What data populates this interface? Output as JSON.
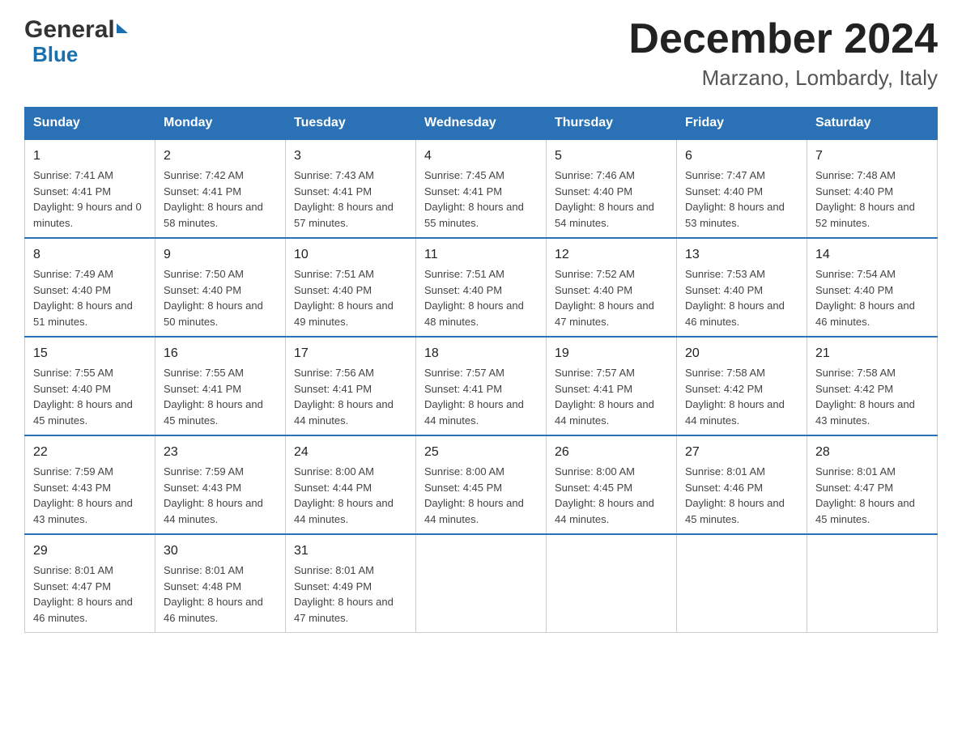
{
  "logo": {
    "line1": "General",
    "line2": "Blue"
  },
  "title": "December 2024",
  "subtitle": "Marzano, Lombardy, Italy",
  "days_of_week": [
    "Sunday",
    "Monday",
    "Tuesday",
    "Wednesday",
    "Thursday",
    "Friday",
    "Saturday"
  ],
  "weeks": [
    [
      {
        "day": "1",
        "sunrise": "7:41 AM",
        "sunset": "4:41 PM",
        "daylight": "9 hours and 0 minutes."
      },
      {
        "day": "2",
        "sunrise": "7:42 AM",
        "sunset": "4:41 PM",
        "daylight": "8 hours and 58 minutes."
      },
      {
        "day": "3",
        "sunrise": "7:43 AM",
        "sunset": "4:41 PM",
        "daylight": "8 hours and 57 minutes."
      },
      {
        "day": "4",
        "sunrise": "7:45 AM",
        "sunset": "4:41 PM",
        "daylight": "8 hours and 55 minutes."
      },
      {
        "day": "5",
        "sunrise": "7:46 AM",
        "sunset": "4:40 PM",
        "daylight": "8 hours and 54 minutes."
      },
      {
        "day": "6",
        "sunrise": "7:47 AM",
        "sunset": "4:40 PM",
        "daylight": "8 hours and 53 minutes."
      },
      {
        "day": "7",
        "sunrise": "7:48 AM",
        "sunset": "4:40 PM",
        "daylight": "8 hours and 52 minutes."
      }
    ],
    [
      {
        "day": "8",
        "sunrise": "7:49 AM",
        "sunset": "4:40 PM",
        "daylight": "8 hours and 51 minutes."
      },
      {
        "day": "9",
        "sunrise": "7:50 AM",
        "sunset": "4:40 PM",
        "daylight": "8 hours and 50 minutes."
      },
      {
        "day": "10",
        "sunrise": "7:51 AM",
        "sunset": "4:40 PM",
        "daylight": "8 hours and 49 minutes."
      },
      {
        "day": "11",
        "sunrise": "7:51 AM",
        "sunset": "4:40 PM",
        "daylight": "8 hours and 48 minutes."
      },
      {
        "day": "12",
        "sunrise": "7:52 AM",
        "sunset": "4:40 PM",
        "daylight": "8 hours and 47 minutes."
      },
      {
        "day": "13",
        "sunrise": "7:53 AM",
        "sunset": "4:40 PM",
        "daylight": "8 hours and 46 minutes."
      },
      {
        "day": "14",
        "sunrise": "7:54 AM",
        "sunset": "4:40 PM",
        "daylight": "8 hours and 46 minutes."
      }
    ],
    [
      {
        "day": "15",
        "sunrise": "7:55 AM",
        "sunset": "4:40 PM",
        "daylight": "8 hours and 45 minutes."
      },
      {
        "day": "16",
        "sunrise": "7:55 AM",
        "sunset": "4:41 PM",
        "daylight": "8 hours and 45 minutes."
      },
      {
        "day": "17",
        "sunrise": "7:56 AM",
        "sunset": "4:41 PM",
        "daylight": "8 hours and 44 minutes."
      },
      {
        "day": "18",
        "sunrise": "7:57 AM",
        "sunset": "4:41 PM",
        "daylight": "8 hours and 44 minutes."
      },
      {
        "day": "19",
        "sunrise": "7:57 AM",
        "sunset": "4:41 PM",
        "daylight": "8 hours and 44 minutes."
      },
      {
        "day": "20",
        "sunrise": "7:58 AM",
        "sunset": "4:42 PM",
        "daylight": "8 hours and 44 minutes."
      },
      {
        "day": "21",
        "sunrise": "7:58 AM",
        "sunset": "4:42 PM",
        "daylight": "8 hours and 43 minutes."
      }
    ],
    [
      {
        "day": "22",
        "sunrise": "7:59 AM",
        "sunset": "4:43 PM",
        "daylight": "8 hours and 43 minutes."
      },
      {
        "day": "23",
        "sunrise": "7:59 AM",
        "sunset": "4:43 PM",
        "daylight": "8 hours and 44 minutes."
      },
      {
        "day": "24",
        "sunrise": "8:00 AM",
        "sunset": "4:44 PM",
        "daylight": "8 hours and 44 minutes."
      },
      {
        "day": "25",
        "sunrise": "8:00 AM",
        "sunset": "4:45 PM",
        "daylight": "8 hours and 44 minutes."
      },
      {
        "day": "26",
        "sunrise": "8:00 AM",
        "sunset": "4:45 PM",
        "daylight": "8 hours and 44 minutes."
      },
      {
        "day": "27",
        "sunrise": "8:01 AM",
        "sunset": "4:46 PM",
        "daylight": "8 hours and 45 minutes."
      },
      {
        "day": "28",
        "sunrise": "8:01 AM",
        "sunset": "4:47 PM",
        "daylight": "8 hours and 45 minutes."
      }
    ],
    [
      {
        "day": "29",
        "sunrise": "8:01 AM",
        "sunset": "4:47 PM",
        "daylight": "8 hours and 46 minutes."
      },
      {
        "day": "30",
        "sunrise": "8:01 AM",
        "sunset": "4:48 PM",
        "daylight": "8 hours and 46 minutes."
      },
      {
        "day": "31",
        "sunrise": "8:01 AM",
        "sunset": "4:49 PM",
        "daylight": "8 hours and 47 minutes."
      },
      null,
      null,
      null,
      null
    ]
  ]
}
